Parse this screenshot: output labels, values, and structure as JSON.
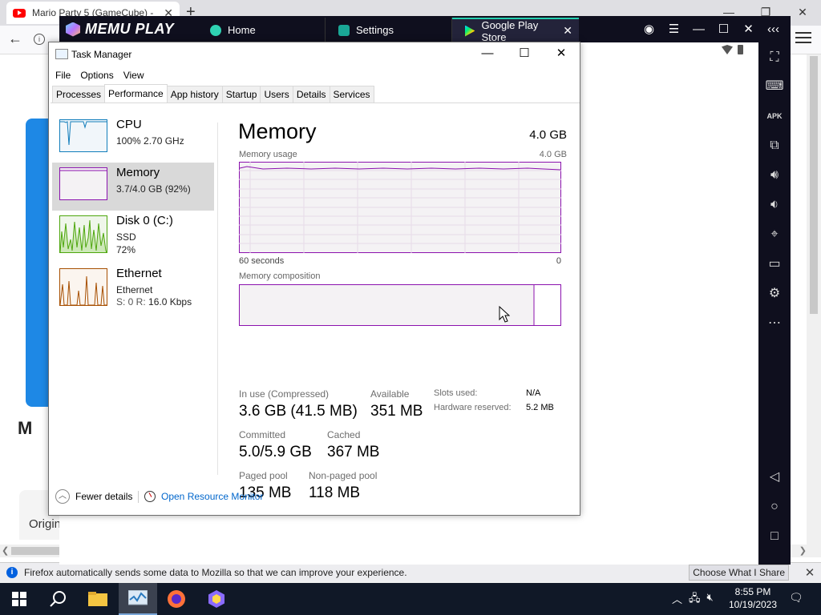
{
  "firefox": {
    "tab_title": "Mario Party 5 (GameCube) -",
    "new_tab": "+",
    "window_controls": [
      "—",
      "❐",
      "✕"
    ],
    "page_heading_fragment": "M",
    "page_card_text": "Origin",
    "notification": {
      "message": "Firefox automatically sends some data to Mozilla so that we can improve your experience.",
      "button": "Choose What I Share"
    }
  },
  "memu": {
    "logo": "MEMU PLAY",
    "tabs": [
      {
        "label": "Home"
      },
      {
        "label": "Settings"
      },
      {
        "label": "Google Play Store"
      }
    ],
    "sidebar_icons": [
      "collapse-icon",
      "fullscreen-icon",
      "keyboard-icon",
      "apk-icon",
      "multi-window-icon",
      "volume-up-icon",
      "volume-down-icon",
      "location-icon",
      "folder-icon",
      "settings-icon",
      "more-icon",
      "back-icon",
      "home-icon",
      "recents-icon"
    ],
    "apk_label": "APK"
  },
  "task_manager": {
    "title": "Task Manager",
    "menu": [
      "File",
      "Options",
      "View"
    ],
    "tabs": [
      "Processes",
      "Performance",
      "App history",
      "Startup",
      "Users",
      "Details",
      "Services"
    ],
    "active_tab": "Performance",
    "resources": [
      {
        "name": "CPU",
        "line1": "100%  2.70 GHz",
        "color": "#117dbb"
      },
      {
        "name": "Memory",
        "line1": "3.7/4.0 GB (92%)",
        "color": "#8b12ae"
      },
      {
        "name": "Disk 0 (C:)",
        "line1": "SSD",
        "line2": "72%",
        "color": "#4da60c"
      },
      {
        "name": "Ethernet",
        "line1": "Ethernet",
        "line2_label": "S: 0  R:",
        "line2_value": "16.0 Kbps",
        "color": "#a74f01"
      }
    ],
    "detail": {
      "title": "Memory",
      "total": "4.0 GB",
      "usage_label": "Memory usage",
      "usage_max": "4.0 GB",
      "x_left": "60 seconds",
      "x_right": "0",
      "composition_label": "Memory composition",
      "stats": {
        "in_use_label": "In use (Compressed)",
        "in_use_value": "3.6 GB (41.5 MB)",
        "available_label": "Available",
        "available_value": "351 MB",
        "committed_label": "Committed",
        "committed_value": "5.0/5.9 GB",
        "cached_label": "Cached",
        "cached_value": "367 MB",
        "paged_label": "Paged pool",
        "paged_value": "135 MB",
        "nonpaged_label": "Non-paged pool",
        "nonpaged_value": "118 MB",
        "slots_label": "Slots used:",
        "slots_value": "N/A",
        "hw_label": "Hardware reserved:",
        "hw_value": "5.2 MB"
      }
    },
    "footer": {
      "fewer_details": "Fewer details",
      "open_resmon": "Open Resource Monitor"
    }
  },
  "taskbar": {
    "time": "8:55 PM",
    "date": "10/19/2023"
  }
}
